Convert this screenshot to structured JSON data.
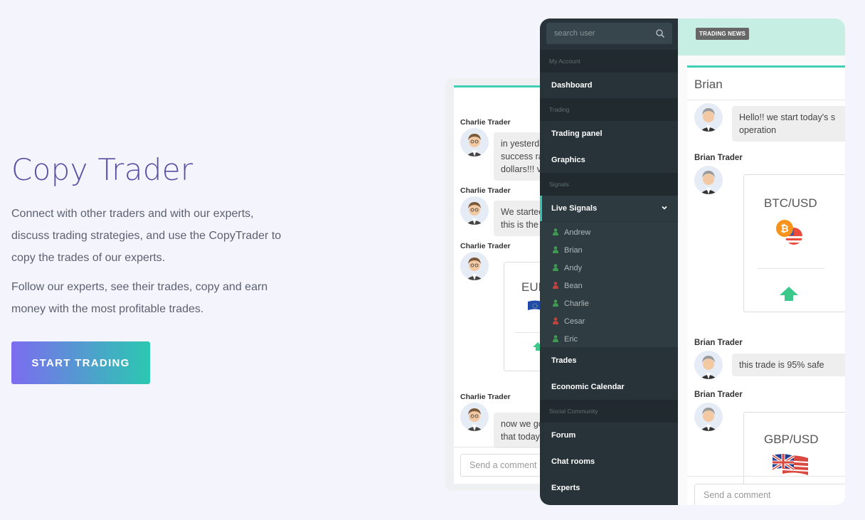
{
  "hero": {
    "title": "Copy Trader",
    "paragraph1_line1": "Connect with other traders and with our experts,",
    "paragraph1_line2": "discuss trading strategies, and use the CopyTrader to",
    "paragraph1_line3": "copy the trades of our experts.",
    "paragraph2_line1": "Follow our experts, see their trades, copy and earn",
    "paragraph2_line2": "money with the most profitable trades.",
    "cta_label": "START TRADING"
  },
  "back_chat": {
    "messages": [
      {
        "author": "Charlie Trader",
        "line1": "in yesterda",
        "line2": "success ra",
        "line3": "dollars!!! v"
      },
      {
        "author": "Charlie Trader",
        "line1": "We startec",
        "line2": "this is the"
      },
      {
        "author": "Charlie Trader",
        "pair": "EUR"
      },
      {
        "author": "Charlie Trader",
        "line1": "now we go",
        "line2": "that today"
      }
    ],
    "send_placeholder": "Send a comment"
  },
  "sidebar": {
    "search_placeholder": "search user",
    "sections": {
      "my_account": "My Account",
      "trading": "Trading",
      "signals": "Signals",
      "social": "Social Community"
    },
    "items": {
      "dashboard": "Dashboard",
      "trading_panel": "Trading panel",
      "graphics": "Graphics",
      "live_signals": "Live Signals",
      "trades": "Trades",
      "economic_calendar": "Economic Calendar",
      "forum": "Forum",
      "chat_rooms": "Chat rooms",
      "experts": "Experts"
    },
    "users": [
      {
        "name": "Andrew",
        "status_color": "#3e9b52"
      },
      {
        "name": "Brian",
        "status_color": "#3e9b52"
      },
      {
        "name": "Andy",
        "status_color": "#3e9b52"
      },
      {
        "name": "Bean",
        "status_color": "#c0433d"
      },
      {
        "name": "Charlie",
        "status_color": "#3e9b52"
      },
      {
        "name": "Cesar",
        "status_color": "#c0433d"
      },
      {
        "name": "Eric",
        "status_color": "#3e9b52"
      }
    ]
  },
  "news": {
    "tag": "TRADING NEWS"
  },
  "main_chat": {
    "title": "Brian",
    "msg1_line1": "Hello!! we start today's s",
    "msg1_line2": "operation",
    "author": "Brian Trader",
    "card1_pair": "BTC/USD",
    "msg3": "this trade is 95% safe",
    "card2_pair": "GBP/USD",
    "send_placeholder": "Send a comment"
  },
  "colors": {
    "accent": "#2bc8b1",
    "title_purple": "#5b4ea3",
    "sidebar_bg": "#273338",
    "online": "#3e9b52",
    "offline": "#c0433d"
  }
}
